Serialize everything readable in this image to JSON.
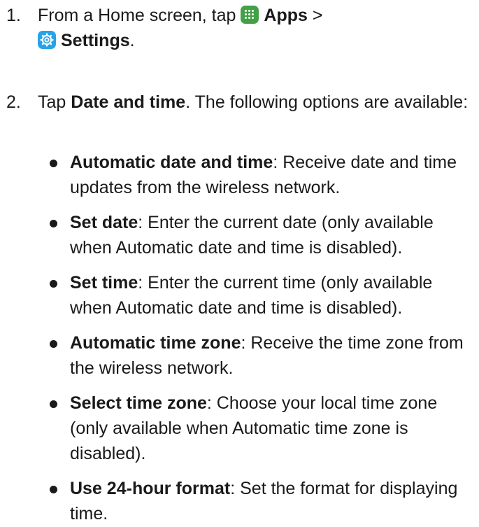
{
  "steps": [
    {
      "num": "1.",
      "pre": "From a Home screen, tap ",
      "apps": "Apps",
      "sep": " >",
      "settings": "Settings",
      "end": "."
    },
    {
      "num": "2.",
      "pre": "Tap ",
      "bold": "Date and time",
      "post": ". The following options are available:"
    }
  ],
  "bullets": [
    {
      "term": "Automatic date and time",
      "desc": ": Receive date and time updates from the wireless network."
    },
    {
      "term": "Set date",
      "desc": ": Enter the current date (only available when Automatic date and time is disabled)."
    },
    {
      "term": "Set time",
      "desc": ": Enter the current time (only available when Automatic date and time is disabled)."
    },
    {
      "term": "Automatic time zone",
      "desc": ": Receive the time zone from the wireless network."
    },
    {
      "term": "Select time zone",
      "desc": ": Choose your local time zone (only available when Automatic time zone is disabled)."
    },
    {
      "term": "Use 24-hour format",
      "desc": ": Set the format for displaying time."
    }
  ],
  "icons": {
    "apps": "apps-icon",
    "settings": "settings-gear-icon",
    "apps_color": "#43a047",
    "settings_color": "#27a3e8"
  }
}
